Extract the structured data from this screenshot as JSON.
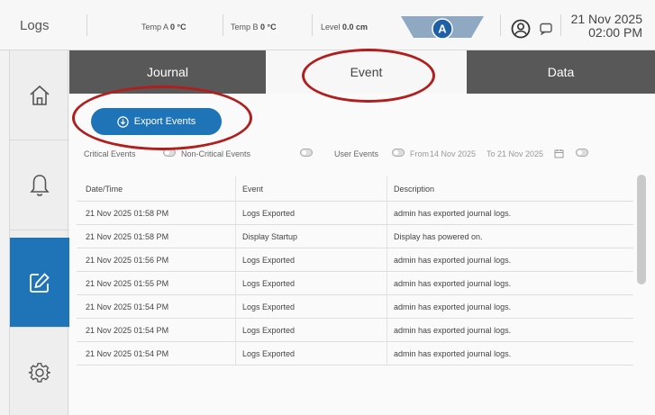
{
  "app": {
    "title": "Logs"
  },
  "status": {
    "temp_a_label": "Temp A",
    "temp_a_value": "0 °C",
    "temp_b_label": "Temp B",
    "temp_b_value": "0 °C",
    "level_label": "Level",
    "level_value": "0.0 cm",
    "mode_badge": "A",
    "date": "21 Nov 2025",
    "time": "02:00 PM"
  },
  "sidebar": {
    "items": [
      {
        "name": "home",
        "icon": "home-icon"
      },
      {
        "name": "alarms",
        "icon": "bell-icon"
      },
      {
        "name": "logs",
        "icon": "edit-icon",
        "active": true
      },
      {
        "name": "settings",
        "icon": "gear-icon"
      }
    ]
  },
  "tabs": [
    {
      "label": "Journal"
    },
    {
      "label": "Event",
      "active": true
    },
    {
      "label": "Data"
    }
  ],
  "toolbar": {
    "export_label": "Export Events"
  },
  "filters": {
    "critical": "Critical Events",
    "non_critical": "Non-Critical Events",
    "user": "User Events",
    "from_label": "From",
    "from_date": "14 Nov 2025",
    "to_label": "To",
    "to_date": "21 Nov 2025"
  },
  "table": {
    "columns": [
      "Date/Time",
      "Event",
      "Description"
    ],
    "rows": [
      [
        "21 Nov 2025 01:58 PM",
        "Logs Exported",
        "admin has exported journal logs."
      ],
      [
        "21 Nov 2025 01:58 PM",
        "Display Startup",
        "Display has powered on."
      ],
      [
        "21 Nov 2025 01:56 PM",
        "Logs Exported",
        "admin has exported journal logs."
      ],
      [
        "21 Nov 2025 01:55 PM",
        "Logs Exported",
        "admin has exported journal logs."
      ],
      [
        "21 Nov 2025 01:54 PM",
        "Logs Exported",
        "admin has exported journal logs."
      ],
      [
        "21 Nov 2025 01:54 PM",
        "Logs Exported",
        "admin has exported journal logs."
      ],
      [
        "21 Nov 2025 01:54 PM",
        "Logs Exported",
        "admin has exported journal logs."
      ]
    ]
  },
  "colors": {
    "accent": "#1f73b7",
    "tab_dark": "#585858",
    "annotation": "#b01e1e"
  }
}
